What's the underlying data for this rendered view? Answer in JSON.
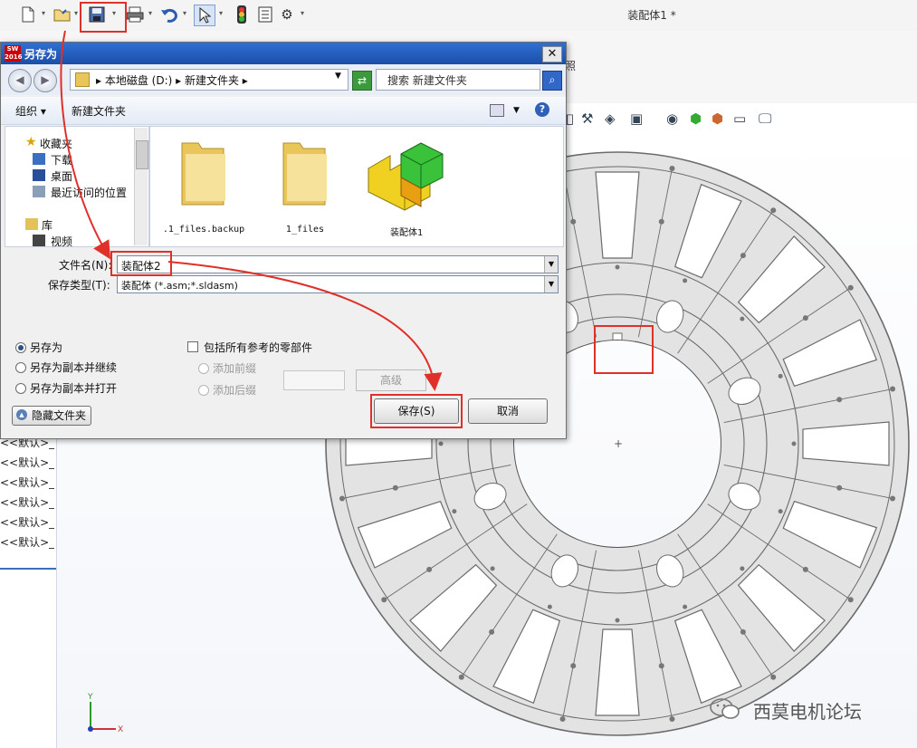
{
  "app": {
    "document_title": "装配体1 *",
    "partial_label": "照"
  },
  "toolbar": {
    "icons": [
      "new-document-icon",
      "open-folder-icon",
      "save-icon",
      "print-icon",
      "undo-icon",
      "select-arrow-icon",
      "traffic-light-icon",
      "options-list-icon",
      "gear-icon"
    ]
  },
  "dialog": {
    "title": "另存为",
    "logo": "SW 2016",
    "address": {
      "path": "▸ 本地磁盘 (D:) ▸ 新建文件夹 ▸"
    },
    "search_placeholder": "搜索 新建文件夹",
    "commands": {
      "organize": "组织 ▾",
      "new_folder": "新建文件夹"
    },
    "nav": {
      "favorites": "收藏夹",
      "downloads": "下载",
      "desktop": "桌面",
      "recent": "最近访问的位置",
      "libraries": "库",
      "videos": "视频"
    },
    "files": [
      {
        "name": ".1_files.backup",
        "type": "folder"
      },
      {
        "name": "1_files",
        "type": "folder"
      },
      {
        "name": "装配体1",
        "type": "assembly"
      }
    ],
    "filename_label": "文件名(N):",
    "filename_value": "装配体2",
    "filetype_label": "保存类型(T):",
    "filetype_value": "装配体 (*.asm;*.sldasm)",
    "options": {
      "save_as": "另存为",
      "save_copy_continue": "另存为副本并继续",
      "save_copy_open": "另存为副本并打开",
      "include_refs": "包括所有参考的零部件",
      "add_prefix": "添加前缀",
      "add_suffix": "添加后缀",
      "selected": "save_as"
    },
    "advanced_button": "高级",
    "save_button": "保存(S)",
    "cancel_button": "取消",
    "hide_folders": "隐藏文件夹"
  },
  "feature_tree": {
    "items": [
      "<<默认>_显",
      "<<默认>_显",
      "<<默认>_显",
      "<<默认>_显",
      "<<默认>_显",
      "<<默认>_显"
    ]
  },
  "watermark": "西莫电机论坛",
  "colors": {
    "annotation": "#e0302a",
    "title_bar": "#2f6fd4",
    "model_face": "#e3e3e3",
    "model_edge": "#6b6b6b"
  }
}
